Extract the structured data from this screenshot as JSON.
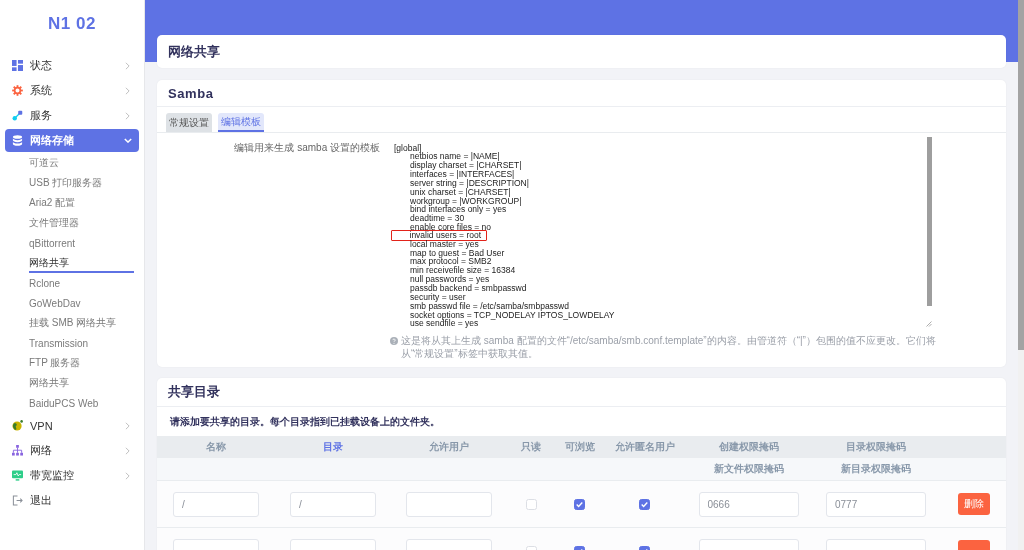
{
  "sidebar": {
    "logo": "N1 02",
    "items": [
      {
        "label": "状态",
        "kind": "group",
        "selected": false,
        "expanded": false
      },
      {
        "label": "系统",
        "kind": "group",
        "selected": false,
        "expanded": false
      },
      {
        "label": "服务",
        "kind": "group",
        "selected": false,
        "expanded": false
      },
      {
        "label": "网络存储",
        "kind": "group",
        "selected": true,
        "expanded": true,
        "children": [
          {
            "label": "可道云",
            "selected": false
          },
          {
            "label": "USB 打印服务器",
            "selected": false
          },
          {
            "label": "Aria2 配置",
            "selected": false
          },
          {
            "label": "文件管理器",
            "selected": false
          },
          {
            "label": "qBittorrent",
            "selected": false
          },
          {
            "label": "网络共享",
            "selected": true
          },
          {
            "label": "Rclone",
            "selected": false
          },
          {
            "label": "GoWebDav",
            "selected": false
          },
          {
            "label": "挂载 SMB 网络共享",
            "selected": false
          },
          {
            "label": "Transmission",
            "selected": false
          },
          {
            "label": "FTP 服务器",
            "selected": false
          },
          {
            "label": "网络共享",
            "selected": false
          },
          {
            "label": "BaiduPCS Web",
            "selected": false
          }
        ]
      },
      {
        "label": "VPN",
        "kind": "group",
        "selected": false,
        "expanded": false
      },
      {
        "label": "网络",
        "kind": "group",
        "selected": false,
        "expanded": false
      },
      {
        "label": "带宽监控",
        "kind": "group",
        "selected": false,
        "expanded": false
      },
      {
        "label": "退出",
        "kind": "link",
        "selected": false
      }
    ]
  },
  "page": {
    "title": "网络共享"
  },
  "samba": {
    "title": "Samba",
    "tabs": [
      {
        "label": "常规设置",
        "selected": false
      },
      {
        "label": "编辑模板",
        "selected": true
      }
    ],
    "template": {
      "label": "编辑用来生成 samba 设置的模板",
      "lines": [
        {
          "text": "[global]",
          "highlighted": false
        },
        {
          "text": "\tnetbios name = |NAME|",
          "highlighted": false
        },
        {
          "text": "\tdisplay charset = |CHARSET|",
          "highlighted": false
        },
        {
          "text": "\tinterfaces = |INTERFACES|",
          "highlighted": false
        },
        {
          "text": "\tserver string = |DESCRIPTION|",
          "highlighted": false
        },
        {
          "text": "\tunix charset = |CHARSET|",
          "highlighted": false
        },
        {
          "text": "\tworkgroup = |WORKGROUP|",
          "highlighted": false
        },
        {
          "text": "\tbind interfaces only = yes",
          "highlighted": false
        },
        {
          "text": "\tdeadtime = 30",
          "highlighted": false
        },
        {
          "text": "\tenable core files = no",
          "highlighted": false
        },
        {
          "text": "\tinvalid users = root",
          "highlighted": true
        },
        {
          "text": "\tlocal master = yes",
          "highlighted": false
        },
        {
          "text": "\tmap to guest = Bad User",
          "highlighted": false
        },
        {
          "text": "\tmax protocol = SMB2",
          "highlighted": false
        },
        {
          "text": "\tmin receivefile size = 16384",
          "highlighted": false
        },
        {
          "text": "\tnull passwords = yes",
          "highlighted": false
        },
        {
          "text": "\tpassdb backend = smbpasswd",
          "highlighted": false
        },
        {
          "text": "\tsecurity = user",
          "highlighted": false
        },
        {
          "text": "\tsmb passwd file = /etc/samba/smbpasswd",
          "highlighted": false
        },
        {
          "text": "\tsocket options = TCP_NODELAY IPTOS_LOWDELAY",
          "highlighted": false
        },
        {
          "text": "\tuse sendfile = yes",
          "highlighted": false
        }
      ]
    },
    "hint": "这是将从其上生成 samba 配置的文件“/etc/samba/smb.conf.template”的内容。由管道符（“|”）包围的值不应更改。它们将从“常规设置”标签中获取其值。"
  },
  "shares": {
    "title": "共享目录",
    "description": "请添加要共享的目录。每个目录指到已挂载设备上的文件夹。",
    "columns": [
      {
        "label": "名称",
        "selected": false
      },
      {
        "label": "目录",
        "selected": true
      },
      {
        "label": "允许用户",
        "selected": false
      },
      {
        "label": "只读",
        "selected": false
      },
      {
        "label": "可浏览",
        "selected": false
      },
      {
        "label": "允许匿名用户",
        "selected": false
      },
      {
        "label": "创建权限掩码",
        "sublabel": "新文件权限掩码",
        "selected": false
      },
      {
        "label": "目录权限掩码",
        "sublabel": "新目录权限掩码",
        "selected": false
      }
    ],
    "rows": [
      {
        "name": "/",
        "path": "/",
        "read_only": false,
        "browseable": true,
        "guest_ok": true,
        "create_mask": "0666",
        "dir_mask": "0777",
        "action": "删除"
      },
      {
        "read_only": false,
        "browseable": true,
        "guest_ok": true
      }
    ]
  }
}
